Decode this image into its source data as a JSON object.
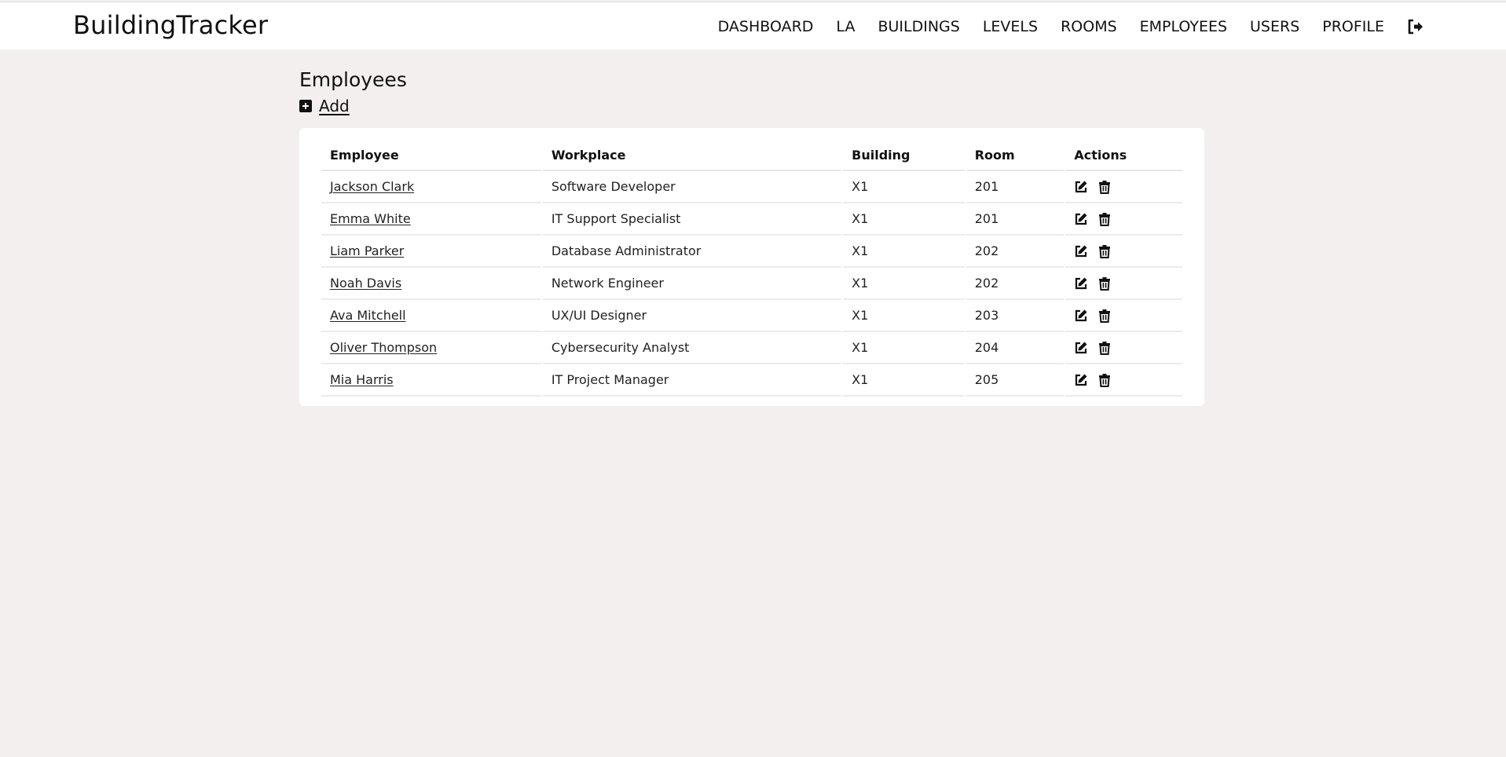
{
  "header": {
    "brand": "BuildingTracker",
    "nav": [
      {
        "label": "DASHBOARD"
      },
      {
        "label": "LA"
      },
      {
        "label": "BUILDINGS"
      },
      {
        "label": "LEVELS"
      },
      {
        "label": "ROOMS"
      },
      {
        "label": "EMPLOYEES"
      },
      {
        "label": "USERS"
      },
      {
        "label": "PROFILE"
      }
    ],
    "logout_icon": "sign-out-icon"
  },
  "page": {
    "title": "Employees",
    "add_label": "Add",
    "add_icon": "plus-square-icon"
  },
  "table": {
    "columns": [
      "Employee",
      "Workplace",
      "Building",
      "Room",
      "Actions"
    ],
    "rows": [
      {
        "employee": "Jackson Clark",
        "workplace": "Software Developer",
        "building": "X1",
        "room": "201"
      },
      {
        "employee": "Emma White",
        "workplace": "IT Support Specialist",
        "building": "X1",
        "room": "201"
      },
      {
        "employee": "Liam Parker",
        "workplace": "Database Administrator",
        "building": "X1",
        "room": "202"
      },
      {
        "employee": "Noah Davis",
        "workplace": "Network Engineer",
        "building": "X1",
        "room": "202"
      },
      {
        "employee": "Ava Mitchell",
        "workplace": "UX/UI Designer",
        "building": "X1",
        "room": "203"
      },
      {
        "employee": "Oliver Thompson",
        "workplace": "Cybersecurity Analyst",
        "building": "X1",
        "room": "204"
      },
      {
        "employee": "Mia Harris",
        "workplace": "IT Project Manager",
        "building": "X1",
        "room": "205"
      }
    ],
    "action_icons": [
      "edit-icon",
      "trash-icon"
    ]
  },
  "colors": {
    "background": "#f4efef",
    "card": "#ffffff",
    "text": "#111111"
  }
}
